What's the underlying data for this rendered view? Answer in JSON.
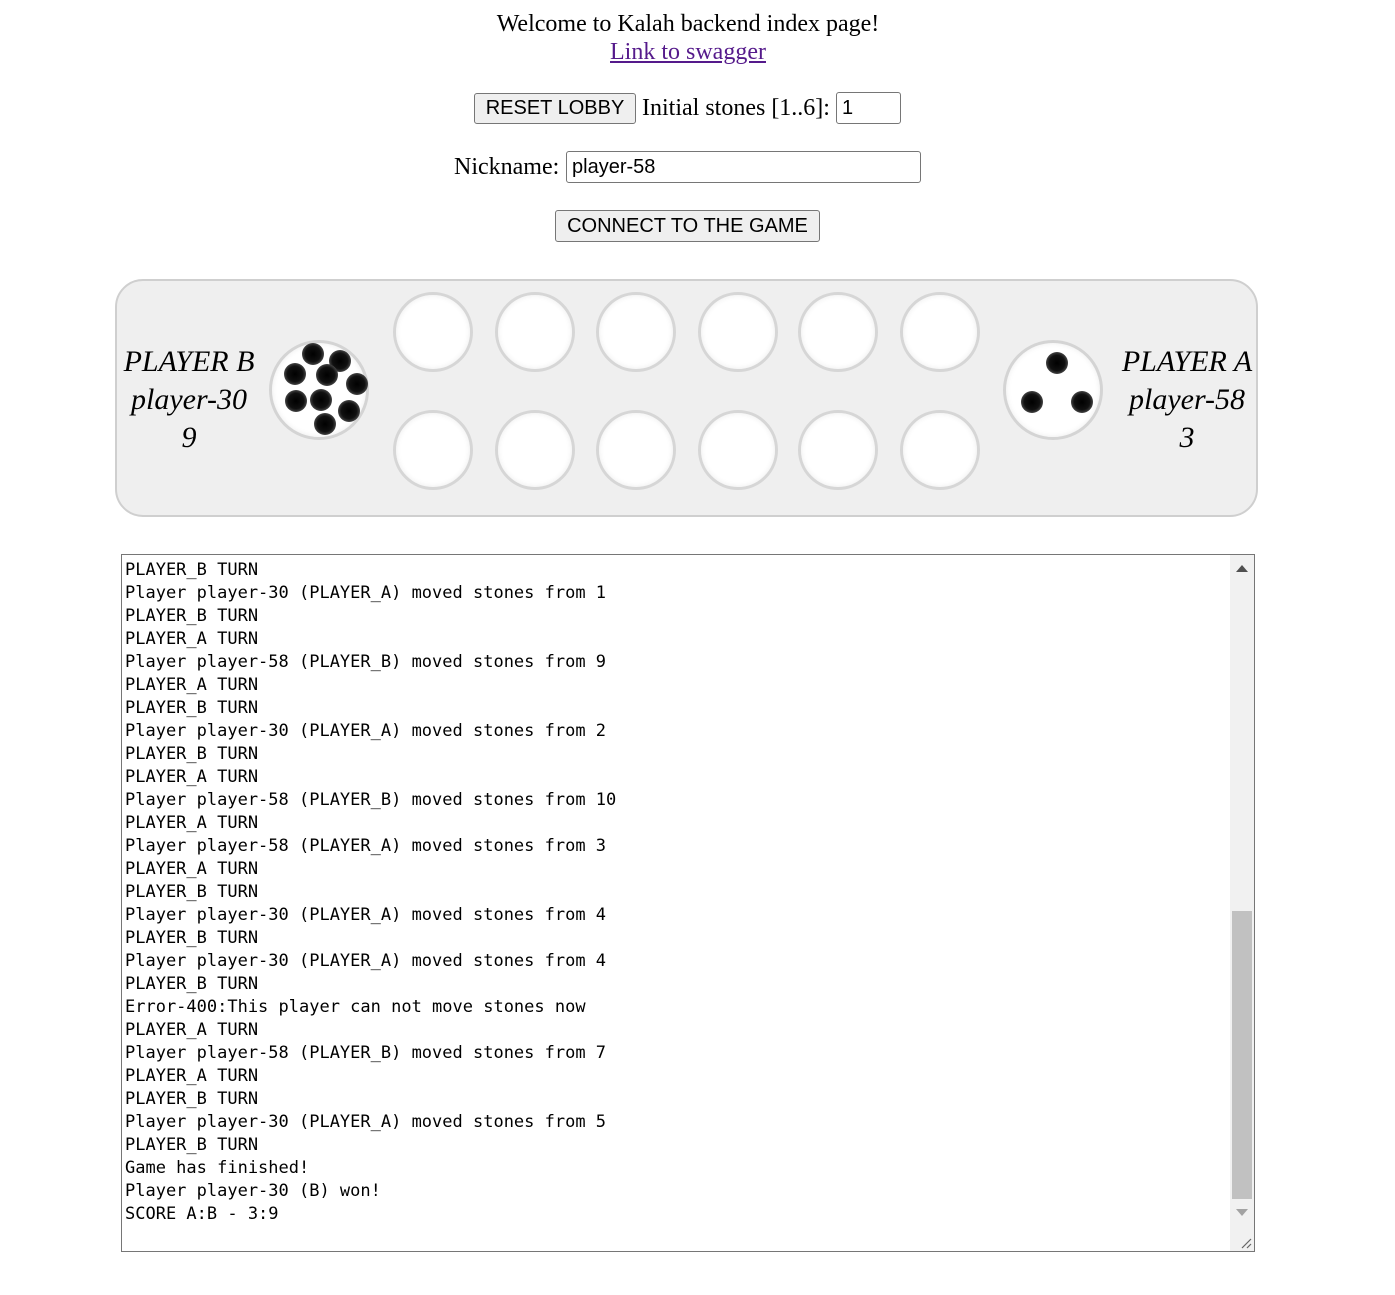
{
  "header": {
    "welcome_text": "Welcome to Kalah backend index page!",
    "swagger_link": "Link to swagger"
  },
  "lobby": {
    "reset_label": "RESET LOBBY",
    "initial_stones_label": "Initial stones [1..6]:",
    "initial_stones_value": "1",
    "nickname_label": "Nickname:",
    "nickname_value": "player-58",
    "connect_label": "CONNECT TO THE GAME"
  },
  "board": {
    "player_b": {
      "role": "PLAYER B",
      "name": "player-30",
      "score": "9",
      "store_stones": 9
    },
    "player_a": {
      "role": "PLAYER A",
      "name": "player-58",
      "score": "3",
      "store_stones": 3
    },
    "pit_rows": {
      "top": [
        0,
        0,
        0,
        0,
        0,
        0
      ],
      "bottom": [
        0,
        0,
        0,
        0,
        0,
        0
      ]
    },
    "stone_color": "#000000",
    "board_color": "#efefef"
  },
  "log": {
    "lines": [
      "PLAYER_B TURN",
      "Player player-30 (PLAYER_A) moved stones from 1",
      "PLAYER_B TURN",
      "PLAYER_A TURN",
      "Player player-58 (PLAYER_B) moved stones from 9",
      "PLAYER_A TURN",
      "PLAYER_B TURN",
      "Player player-30 (PLAYER_A) moved stones from 2",
      "PLAYER_B TURN",
      "PLAYER_A TURN",
      "Player player-58 (PLAYER_B) moved stones from 10",
      "PLAYER_A TURN",
      "Player player-58 (PLAYER_A) moved stones from 3",
      "PLAYER_A TURN",
      "PLAYER_B TURN",
      "Player player-30 (PLAYER_A) moved stones from 4",
      "PLAYER_B TURN",
      "Player player-30 (PLAYER_A) moved stones from 4",
      "PLAYER_B TURN",
      "Error-400:This player can not move stones now",
      "PLAYER_A TURN",
      "Player player-58 (PLAYER_B) moved stones from 7",
      "PLAYER_A TURN",
      "PLAYER_B TURN",
      "Player player-30 (PLAYER_A) moved stones from 5",
      "PLAYER_B TURN",
      "Game has finished!",
      "Player player-30 (B) won!",
      "SCORE A:B - 3:9"
    ]
  }
}
